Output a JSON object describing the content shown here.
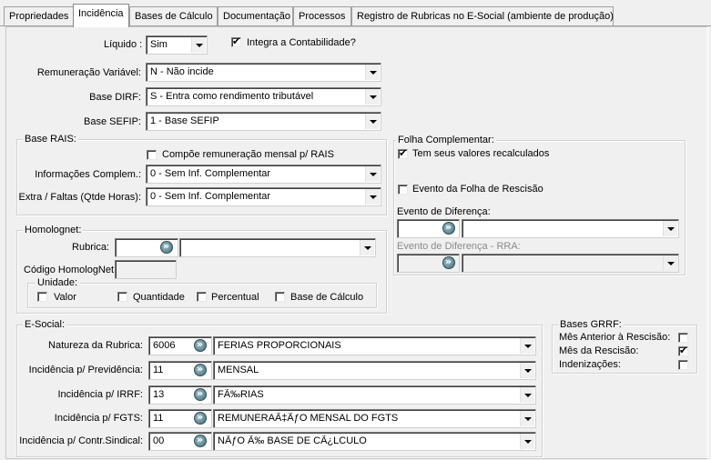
{
  "tabs": [
    "Propriedades",
    "Incidência",
    "Bases de Cálculo",
    "Documentação",
    "Processos",
    "Registro de Rubricas no E-Social (ambiente de produção)"
  ],
  "active_tab": "Incidência",
  "top": {
    "liquido_label": "Líquido :",
    "liquido_value": "Sim",
    "integra_label": "Integra a Contabilidade?",
    "integra_checked": true,
    "rem_var_label": "Remuneração Variável:",
    "rem_var_value": "N - Não incide",
    "base_dirf_label": "Base DIRF:",
    "base_dirf_value": "S - Entra como rendimento tributável",
    "base_sefip_label": "Base SEFIP:",
    "base_sefip_value": "1 - Base SEFIP"
  },
  "rais": {
    "title": "Base RAIS:",
    "compoe_label": "Compõe remuneração mensal p/ RAIS",
    "compoe_checked": false,
    "info_label": "Informações Complem.:",
    "info_value": "0 - Sem Inf. Complementar",
    "extra_label": "Extra / Faltas (Qtde Horas):",
    "extra_value": "0 - Sem Inf. Complementar"
  },
  "folha": {
    "title": "Folha Complementar:",
    "tem_label": "Tem seus valores recalculados",
    "tem_checked": true,
    "evento_resc_label": "Evento da Folha de Rescisão",
    "evento_resc_checked": false,
    "evento_dif_label": "Evento de Diferença:",
    "evento_dif_rra_label": "Evento de Diferença - RRA:"
  },
  "homolog": {
    "title": "Homolognet:",
    "rubrica_label": "Rubrica:",
    "codigo_label": "Código HomologNet",
    "unidade_title": "Unidade:",
    "unidades": [
      "Valor",
      "Quantidade",
      "Percentual",
      "Base de Cálculo"
    ]
  },
  "esocial": {
    "title": "E-Social:",
    "rows": [
      {
        "label": "Natureza da Rubrica:",
        "code": "6006",
        "desc": "FERIAS PROPORCIONAIS"
      },
      {
        "label": "Incidência p/ Previdência:",
        "code": "11",
        "desc": "MENSAL"
      },
      {
        "label": "Incidência p/ IRRF:",
        "code": "13",
        "desc": "FÃ‰RIAS"
      },
      {
        "label": "Incidência p/ FGTS:",
        "code": "11",
        "desc": "REMUNERAÃ‡ÃƒO MENSAL DO FGTS"
      },
      {
        "label": "Incidência p/ Contr.Sindical:",
        "code": "00",
        "desc": "NÃƒO Ã‰ BASE DE CÃ¿LCULO"
      }
    ]
  },
  "grrf": {
    "title": "Bases GRRF:",
    "items": [
      {
        "label": "Mês Anterior à Rescisão:",
        "checked": false
      },
      {
        "label": "Mês da Rescisão:",
        "checked": true
      },
      {
        "label": "Indenizações:",
        "checked": false
      }
    ]
  }
}
